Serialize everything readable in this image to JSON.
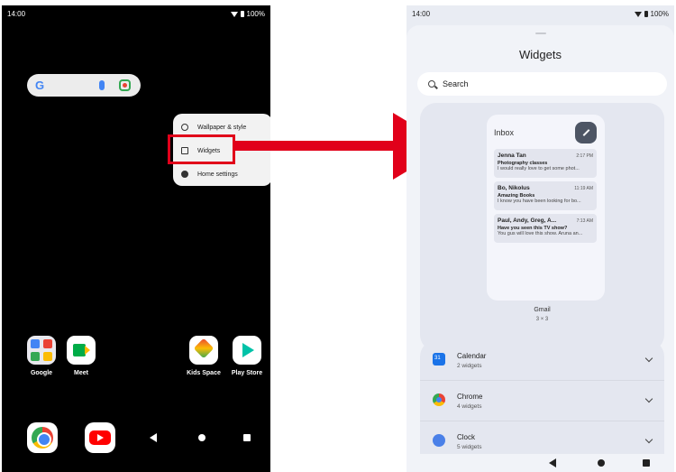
{
  "left_screen": {
    "status": {
      "time": "14:00",
      "battery": "100%"
    },
    "search_widget": {
      "logo": "G",
      "icons": [
        "mic-icon",
        "lens-icon"
      ]
    },
    "context_menu": {
      "items": [
        {
          "label": "Wallpaper & style",
          "icon": "palette-icon"
        },
        {
          "label": "Widgets",
          "icon": "widgets-grid-icon",
          "highlighted": true
        },
        {
          "label": "Home settings",
          "icon": "gear-icon"
        }
      ]
    },
    "apps": [
      {
        "label": "Google",
        "icon": "google-folder-icon"
      },
      {
        "label": "Meet",
        "icon": "meet-icon"
      },
      {
        "label": "Kids Space",
        "icon": "kids-space-icon"
      },
      {
        "label": "Play Store",
        "icon": "play-store-icon"
      }
    ],
    "dock": [
      "chrome-icon",
      "youtube-icon"
    ],
    "colors": {
      "highlight": "#e1001a",
      "background": "#000000"
    }
  },
  "right_screen": {
    "status": {
      "time": "14:00",
      "battery": "100%"
    },
    "title": "Widgets",
    "search_placeholder": "Search",
    "gmail_widget": {
      "header": "Inbox",
      "emails": [
        {
          "from": "Jenna Tan",
          "time": "2:17 PM",
          "subject": "Photography classes",
          "snippet": "I would really love to get some phot..."
        },
        {
          "from": "Bo, Nikolus",
          "time": "11:19 AM",
          "subject": "Amazing Books",
          "snippet": "I know you have been looking for bo..."
        },
        {
          "from": "Paul, Andy, Greg, A...",
          "time": "7:13 AM",
          "subject": "Have you seen this TV show?",
          "snippet": "You gus will love this show. Aruna an..."
        }
      ],
      "name": "Gmail",
      "size": "3 × 3"
    },
    "apps": [
      {
        "name": "Calendar",
        "count": "2 widgets",
        "icon": "calendar-icon"
      },
      {
        "name": "Chrome",
        "count": "4 widgets",
        "icon": "chrome-icon"
      },
      {
        "name": "Clock",
        "count": "5 widgets",
        "icon": "clock-icon"
      }
    ]
  }
}
